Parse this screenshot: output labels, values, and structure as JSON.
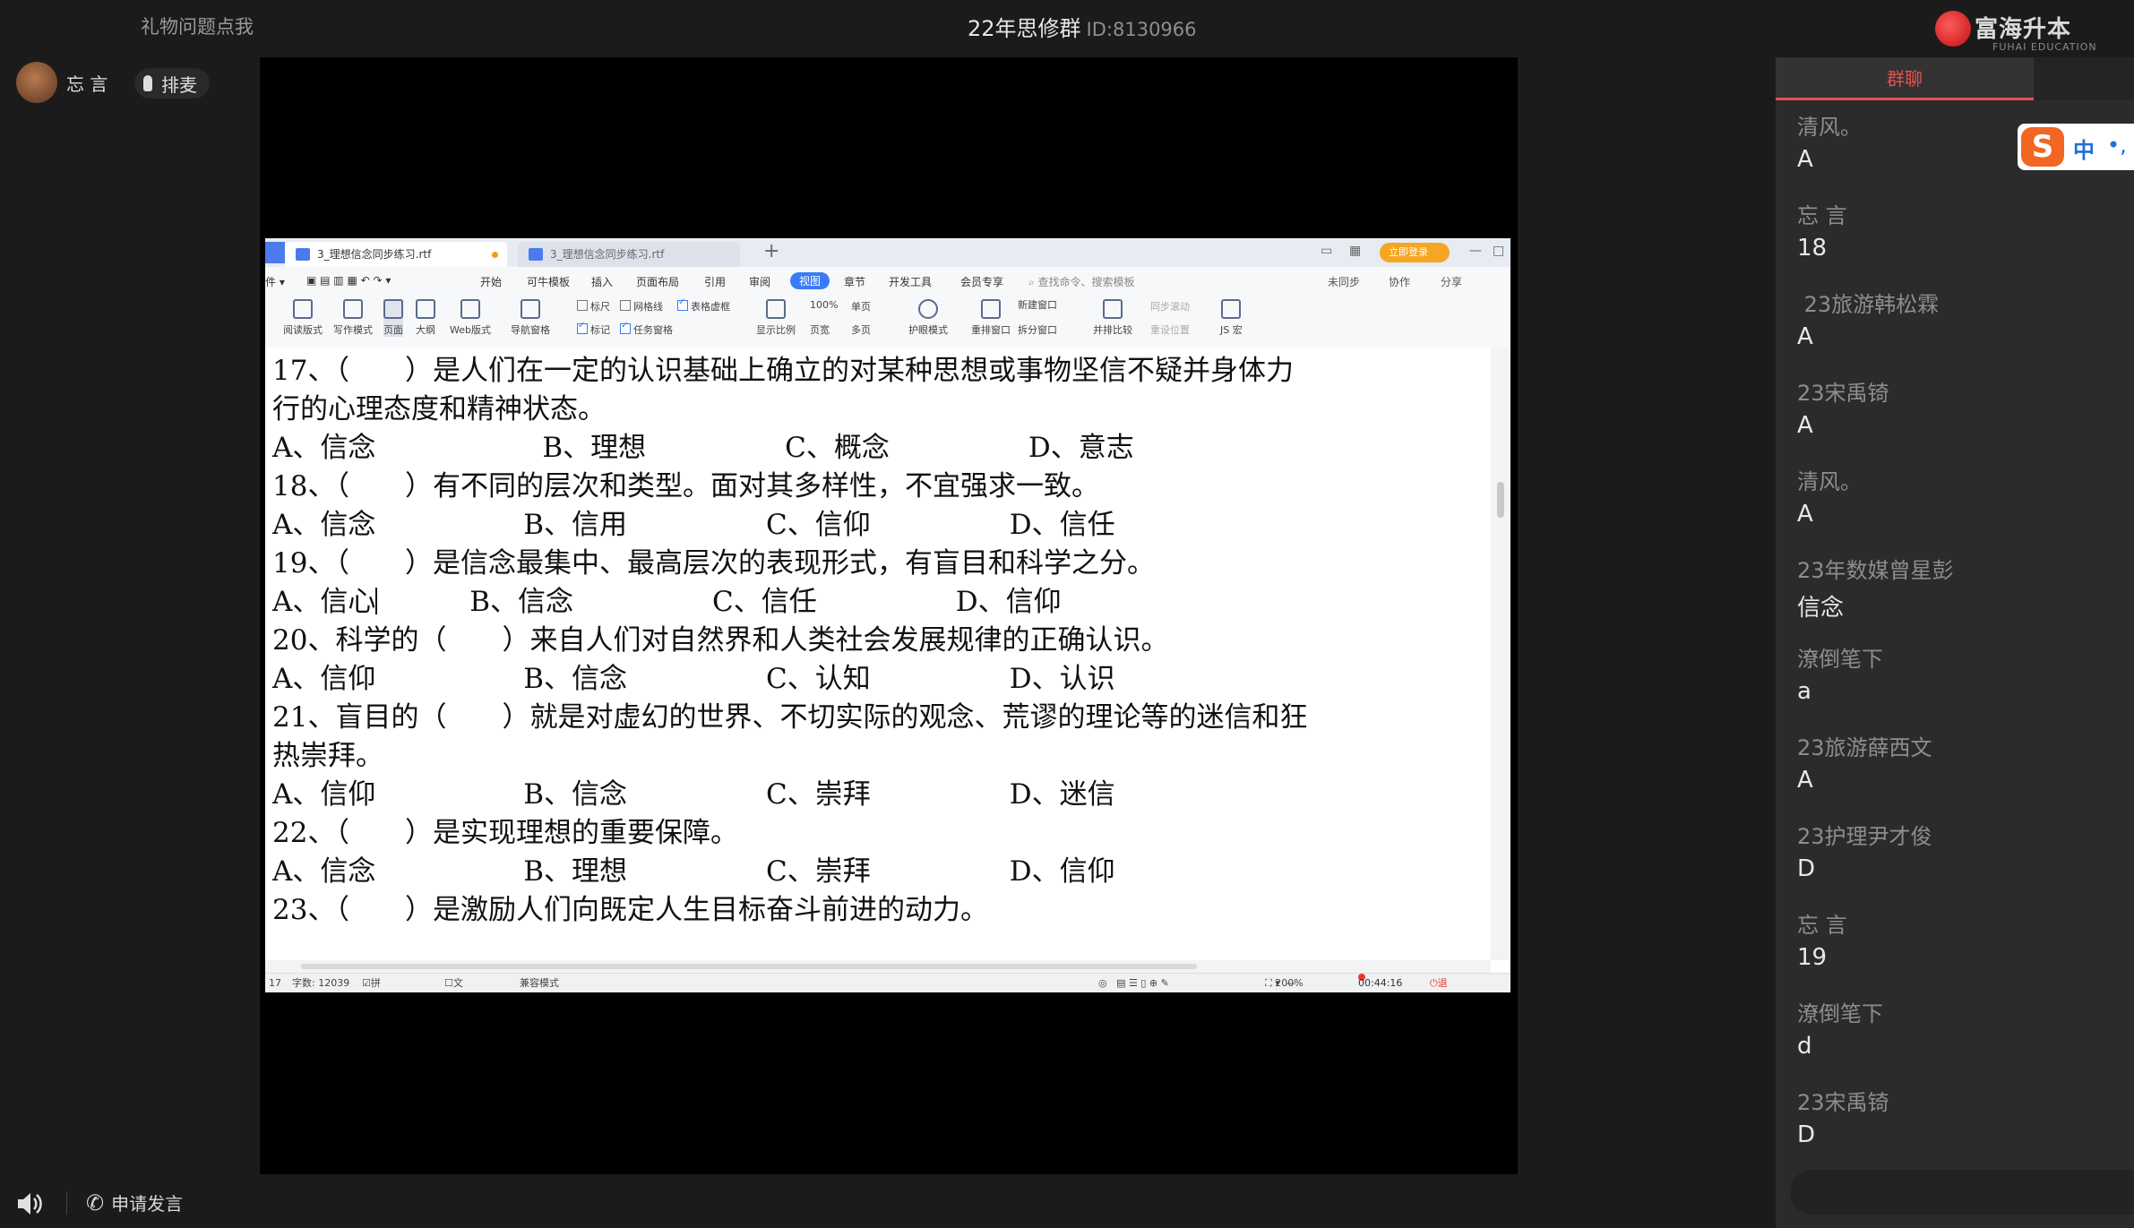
{
  "topbar": {
    "gift_link": "礼物问题点我",
    "room_title": "22年思修群",
    "room_id": "ID:8130966",
    "brand_name": "富海升本",
    "brand_sub": "FUHAI EDUCATION"
  },
  "host": {
    "name": "忘 言",
    "mic_label": "排麦"
  },
  "wps": {
    "tabs": [
      "3_理想信念同步练习.rtf",
      "3_理想信念同步练习.rtf"
    ],
    "login_label": "立即登录",
    "menu": [
      "开始",
      "可牛模板",
      "插入",
      "页面布局",
      "引用",
      "审阅",
      "视图",
      "章节",
      "开发工具",
      "会员专享"
    ],
    "active_menu": "视图",
    "search_placeholder": "查找命令、搜索模板",
    "menu_right": [
      "未同步",
      "协作",
      "分享"
    ],
    "ribbon": {
      "views": [
        "阅读版式",
        "写作模式",
        "页面",
        "大纲",
        "Web版式"
      ],
      "nav": "导航窗格",
      "checks": [
        "标尺",
        "网格线",
        "表格虚框",
        "标记",
        "任务窗格"
      ],
      "zoom": [
        "显示比例",
        "100%",
        "单页",
        "页宽",
        "多页"
      ],
      "eye": "护眼模式",
      "windows": [
        "重排窗口",
        "新建窗口",
        "拆分窗口"
      ],
      "compare": "并排比较",
      "sync": [
        "同步滚动",
        "重设位置"
      ],
      "macro": "JS 宏"
    },
    "doc_lines": [
      "17、（　　）是人们在一定的认识基础上确立的对某种思想或事物坚信不疑并身体力",
      "行的心理态度和精神状态。",
      "A、信念　　　　　　B、理想　　　　　C、概念　　　　　D、意志",
      "18、（　　）有不同的层次和类型。面对其多样性，不宜强求一致。",
      "A、信念　　　　　 B、信用　　　　　C、信仰　　　　　D、信任",
      "19、（　　）是信念最集中、最高层次的表现形式，有盲目和科学之分。",
      "A、信心",
      "20、科学的（　　）来自人们对自然界和人类社会发展规律的正确认识。",
      "A、信仰　　　　　 B、信念　　　　　C、认知　　　　　D、认识",
      "21、盲目的（　　）就是对虚幻的世界、不切实际的观念、荒谬的理论等的迷信和狂",
      "热崇拜。",
      "A、信仰　　　　　 B、信念　　　　　C、崇拜　　　　　D、迷信",
      "22、（　　）是实现理想的重要保障。",
      "A、信念　　　　　 B、理想　　　　　C、崇拜　　　　　D、信仰",
      "23、（　　）是激励人们向既定人生目标奋斗前进的动力。"
    ],
    "line19_rest": "　　　 B、信念　　　　　C、信任　　　　　D、信仰",
    "status": {
      "page": "17",
      "words": "字数: 12039",
      "spell": "拼写检查",
      "doc_check": "文档校对",
      "compat": "兼容模式",
      "zoom": "200%",
      "timer": "00:44:16",
      "exit_share": "退出分享"
    }
  },
  "chat": {
    "tab_label": "群聊",
    "messages": [
      {
        "user": "清风。",
        "text": "A"
      },
      {
        "user": "忘 言",
        "text": "18"
      },
      {
        "user": " 23旅游韩松霖",
        "text": "A"
      },
      {
        "user": "23宋禹锜",
        "text": "A"
      },
      {
        "user": "清风。",
        "text": "A"
      },
      {
        "user": "23年数媒曾星彭",
        "text": "信念"
      },
      {
        "user": "潦倒笔下",
        "text": "a"
      },
      {
        "user": "23旅游薛西文",
        "text": "A"
      },
      {
        "user": "23护理尹才俊",
        "text": "D"
      },
      {
        "user": "忘 言",
        "text": "19"
      },
      {
        "user": "潦倒笔下",
        "text": "d"
      },
      {
        "user": "23宋禹锜",
        "text": "D"
      }
    ]
  },
  "ime": {
    "logo": "S",
    "mode": "中",
    "punct": "•,"
  },
  "bottom": {
    "apply_label": "申请发言"
  },
  "colors": {
    "accent": "#e8524a",
    "wps_blue": "#3a7bf7",
    "login_orange": "#f5a623"
  }
}
